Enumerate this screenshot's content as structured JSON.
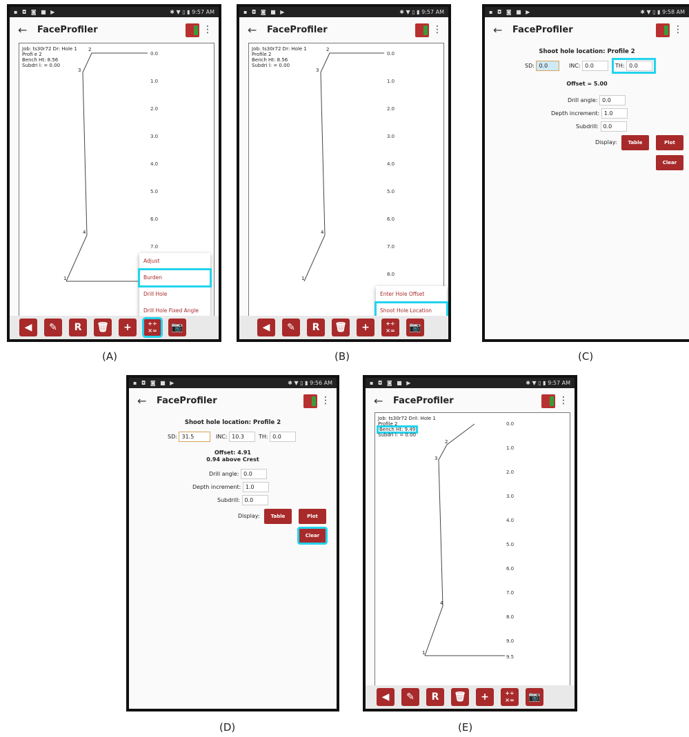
{
  "status": {
    "icons": "▪ ◘ ◙ ■ ▶",
    "time_a": "9:57 AM",
    "time_b": "9:57 AM",
    "time_c": "9:58 AM",
    "time_d": "9:56 AM",
    "time_e": "9:57 AM",
    "right_icons": "✱ ▼ ▯ ▮"
  },
  "app": {
    "title": "FaceProfiler",
    "back_glyph": "←",
    "menu_glyph": "⋮"
  },
  "captions": [
    "(A)",
    "(B)",
    "(C)",
    "(D)",
    "(E)"
  ],
  "panel_a": {
    "info": [
      "Job: ts30r72 Dr: Hole 1",
      "Profi e 2",
      "Bench Ht: 8.56",
      "Subdri l: = 0.00"
    ],
    "ticks": [
      "0.0",
      "1.0",
      "2.0",
      "3.0",
      "4.0",
      "5.0",
      "6.0",
      "7.0"
    ],
    "points": [
      "2",
      "3",
      "4",
      "1"
    ],
    "menu": [
      "Adjust",
      "Burden",
      "Drill Hole",
      "Drill Hole Fixed Angle"
    ]
  },
  "panel_b": {
    "info": [
      "Job: ts30r72 Dr: Hole 1",
      "Profile 2",
      "Bench Ht: 8.56",
      "Subdri l: = 0.00"
    ],
    "ticks": [
      "0.0",
      "1.0",
      "2.0",
      "3.0",
      "4.0",
      "5.0",
      "6.0",
      "7.0",
      "8.0"
    ],
    "points": [
      "2",
      "3",
      "4",
      "1"
    ],
    "menu": [
      "Enter Hole Offset",
      "Shoot Hole Location"
    ]
  },
  "panel_c": {
    "heading": "Shoot hole location: Profile 2",
    "sd_label": "SD:",
    "sd_value": "0.0",
    "inc_label": "INC:",
    "inc_value": "0.0",
    "th_label": "TH:",
    "th_value": "0.0",
    "offset": "Offset = 5.00",
    "drill_angle_label": "Drill angle:",
    "drill_angle": "0.0",
    "depth_inc_label": "Depth increment:",
    "depth_inc": "1.0",
    "subdrill_label": "Subdrill:",
    "subdrill": "0.0",
    "display_label": "Display:",
    "table_btn": "Table",
    "plot_btn": "Plot",
    "clear_btn": "Clear"
  },
  "panel_d": {
    "heading": "Shoot hole location: Profile 2",
    "sd_label": "SD:",
    "sd_value": "31.5",
    "inc_label": "INC:",
    "inc_value": "10.3",
    "th_label": "TH:",
    "th_value": "0.0",
    "offset": "Offset: 4.91",
    "crest": "0.94 above Crest",
    "drill_angle_label": "Drill angle:",
    "drill_angle": "0.0",
    "depth_inc_label": "Depth increment:",
    "depth_inc": "1.0",
    "subdrill_label": "Subdrill:",
    "subdrill": "0.0",
    "display_label": "Display:",
    "table_btn": "Table",
    "plot_btn": "Plot",
    "clear_btn": "Clear"
  },
  "panel_e": {
    "info": [
      "Job: ts30r72 Dril: Hole 1",
      "Profile 2",
      "Bench Ht: 9.49",
      "Subdri l: = 0.00"
    ],
    "ticks": [
      "0.0",
      "1.0",
      "2.0",
      "3.0",
      "4.0",
      "5.0",
      "6.0",
      "7.0",
      "8.0",
      "9.0",
      "9.5"
    ],
    "points": [
      "2",
      "3",
      "4",
      "1"
    ]
  },
  "toolbar": {
    "undo": "◀",
    "edit": "✎",
    "r": "R",
    "trash": "🗑",
    "add": "+",
    "calc": "+÷ ×=",
    "camera": "📷"
  },
  "colors": {
    "accent": "#a82a2a",
    "highlight": "#22d3ee"
  }
}
